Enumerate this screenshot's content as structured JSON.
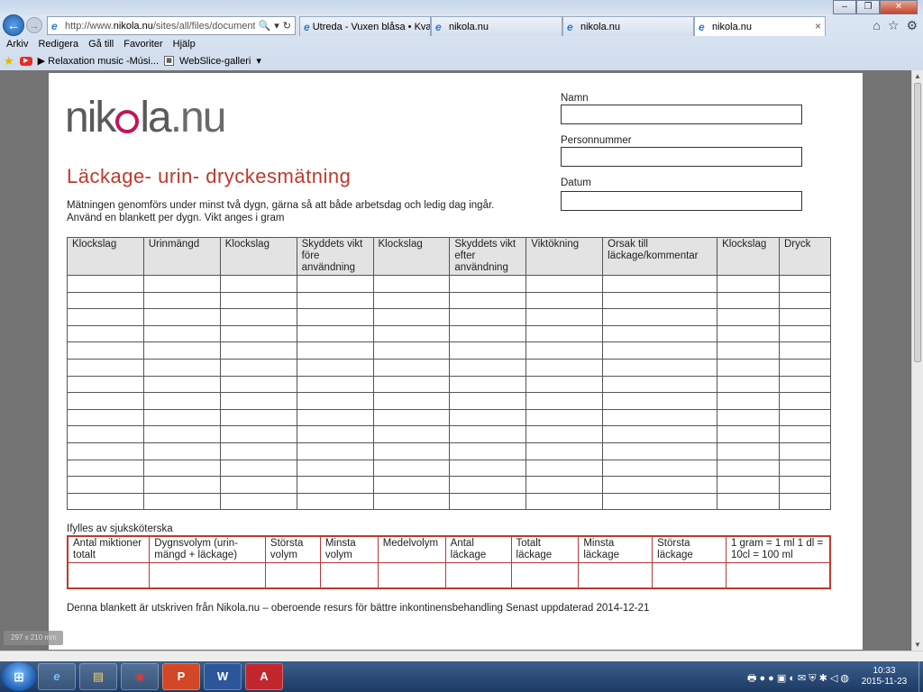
{
  "browser": {
    "address": {
      "url_prefix": "http://www.",
      "url_host": "nikola.nu",
      "url_rest": "/sites/all/files/documents/blankett",
      "search_glyph": "🔍",
      "dropdown_glyph": "▾",
      "refresh_glyph": "↻"
    },
    "back_glyph": "←",
    "forward_glyph": "→",
    "tabs": [
      {
        "label": "Utreda - Vuxen blåsa • Kvalitets..."
      },
      {
        "label": "nikola.nu"
      },
      {
        "label": "nikola.nu"
      },
      {
        "label": "nikola.nu"
      }
    ],
    "tab_close_glyph": "×",
    "window_buttons": {
      "minimize": "–",
      "maximize": "❐",
      "close": "✕"
    },
    "right_icons": {
      "home": "⌂",
      "favorites": "☆",
      "tools": "⚙"
    },
    "menu": [
      "Arkiv",
      "Redigera",
      "Gå till",
      "Favoriter",
      "Hjälp"
    ],
    "favorites_bar": {
      "yt_item": "▶ Relaxation music -Músi...",
      "webslice": "WebSlice-galleri",
      "dropdown": "▾"
    }
  },
  "document": {
    "logo": {
      "part1": "nik",
      "part2": "la",
      "part3": ".nu"
    },
    "title": "Läckage- urin- dryckesmätning",
    "intro_line1": "Mätningen genomförs under minst två dygn, gärna så att både arbetsdag och ledig dag ingår.",
    "intro_line2": "Använd en blankett per dygn. Vikt anges i gram",
    "fields": {
      "name": "Namn",
      "pnr": "Personnummer",
      "date": "Datum"
    },
    "main_table": {
      "headers": [
        "Klockslag",
        "Urinmängd",
        "Klockslag",
        "Skyddets vikt före användning",
        "Klockslag",
        "Skyddets vikt efter användning",
        "Viktökning",
        "Orsak till läckage/kommentar",
        "Klockslag",
        "Dryck"
      ],
      "row_count": 14
    },
    "nurse_label": "Ifylles av sjuksköterska",
    "nurse_table": {
      "headers": [
        "Antal miktioner totalt",
        "Dygnsvolym (urin-mängd + läckage)",
        "Största volym",
        "Minsta volym",
        "Medelvolym",
        "Antal läckage",
        "Totalt läckage",
        "Minsta läckage",
        "Största läckage",
        "1 gram = 1 ml 1 dl = 10cl = 100 ml"
      ]
    },
    "footer": "Denna blankett är utskriven från Nikola.nu – oberoende resurs för bättre inkontinensbehandling Senast uppdaterad 2014-12-21",
    "size_badge": "297 x 210 mm"
  },
  "taskbar": {
    "start_glyph": "⊞",
    "apps": [
      {
        "name": "ie-icon",
        "glyph": "e"
      },
      {
        "name": "explorer-icon",
        "glyph": "▤"
      },
      {
        "name": "media-icon",
        "glyph": "◉"
      },
      {
        "name": "powerpoint-icon",
        "glyph": "P"
      },
      {
        "name": "word-icon",
        "glyph": "W"
      },
      {
        "name": "pdf-icon",
        "glyph": "A"
      }
    ],
    "tray_glyphs": "🖶 ● ● ▣ ◐ ✉ ⛨ ✱ ◁ ◍",
    "clock_time": "10:33",
    "clock_date": "2015-11-23"
  }
}
